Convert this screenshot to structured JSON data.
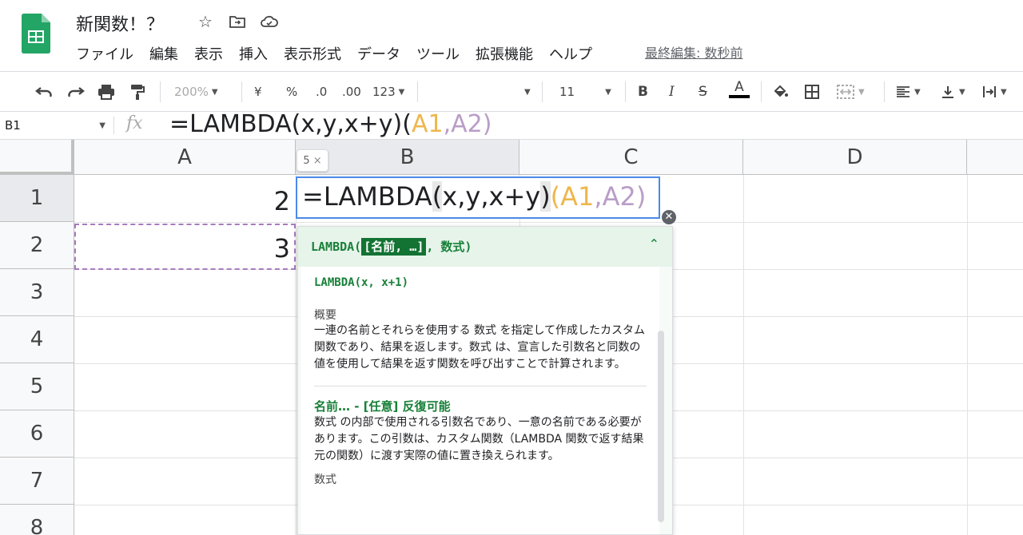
{
  "header": {
    "title": "新関数！？",
    "last_edit": "最終編集: 数秒前",
    "menu": [
      "ファイル",
      "編集",
      "表示",
      "挿入",
      "表示形式",
      "データ",
      "ツール",
      "拡張機能",
      "ヘルプ"
    ]
  },
  "toolbar": {
    "zoom": "200%",
    "currency": "¥",
    "percent": "%",
    "decrease_decimal": ".0",
    "increase_decimal": ".00",
    "number_format": "123",
    "font_size": "11",
    "bold": "B",
    "italic": "I",
    "strike": "S",
    "text_color": "A",
    "text_color_value": "#000000"
  },
  "formula_bar": {
    "name_box": "B1",
    "fx": "fx",
    "formula_main": "=LAMBDA(x,y,x+y)(",
    "arg1": "A1",
    "comma": ",",
    "arg2": "A2",
    "close": ")"
  },
  "grid": {
    "columns": [
      "A",
      "B",
      "C",
      "D"
    ],
    "rows": [
      "1",
      "2",
      "3",
      "4",
      "5",
      "6",
      "7",
      "8"
    ],
    "cells": {
      "A1": "2",
      "A2": "3"
    }
  },
  "editor": {
    "prefix": "=LAMBDA",
    "open1": "(",
    "body": "x,y,x+y",
    "close1": ")",
    "open2": "(",
    "arg1": "A1",
    "comma": ",",
    "arg2": "A2",
    "close2": ")",
    "result_preview": "5",
    "result_close": "×"
  },
  "help": {
    "signature_prefix": "LAMBDA(",
    "signature_param": "[名前, …]",
    "signature_suffix": ", 数式)",
    "example": "LAMBDA(x, x+1)",
    "summary_title": "概要",
    "summary_text": "一連の名前とそれらを使用する 数式 を指定して作成したカスタム関数であり、結果を返します。数式 は、宣言した引数名と同数の値を使用して結果を返す関数を呼び出すことで計算されます。",
    "param_title": "名前… - [任意] 反復可能",
    "param_text": "数式 の内部で使用される引数名であり、一意の名前である必要があります。この引数は、カスタム関数（LAMBDA 関数で返す結果元の関数）に渡す実際の値に置き換えられます。",
    "next_title": "数式"
  },
  "colors": {
    "accent_green": "#188038",
    "selection_blue": "#4b89e8",
    "ref_orange": "#eeb64c",
    "ref_purple": "#b99dc7"
  }
}
